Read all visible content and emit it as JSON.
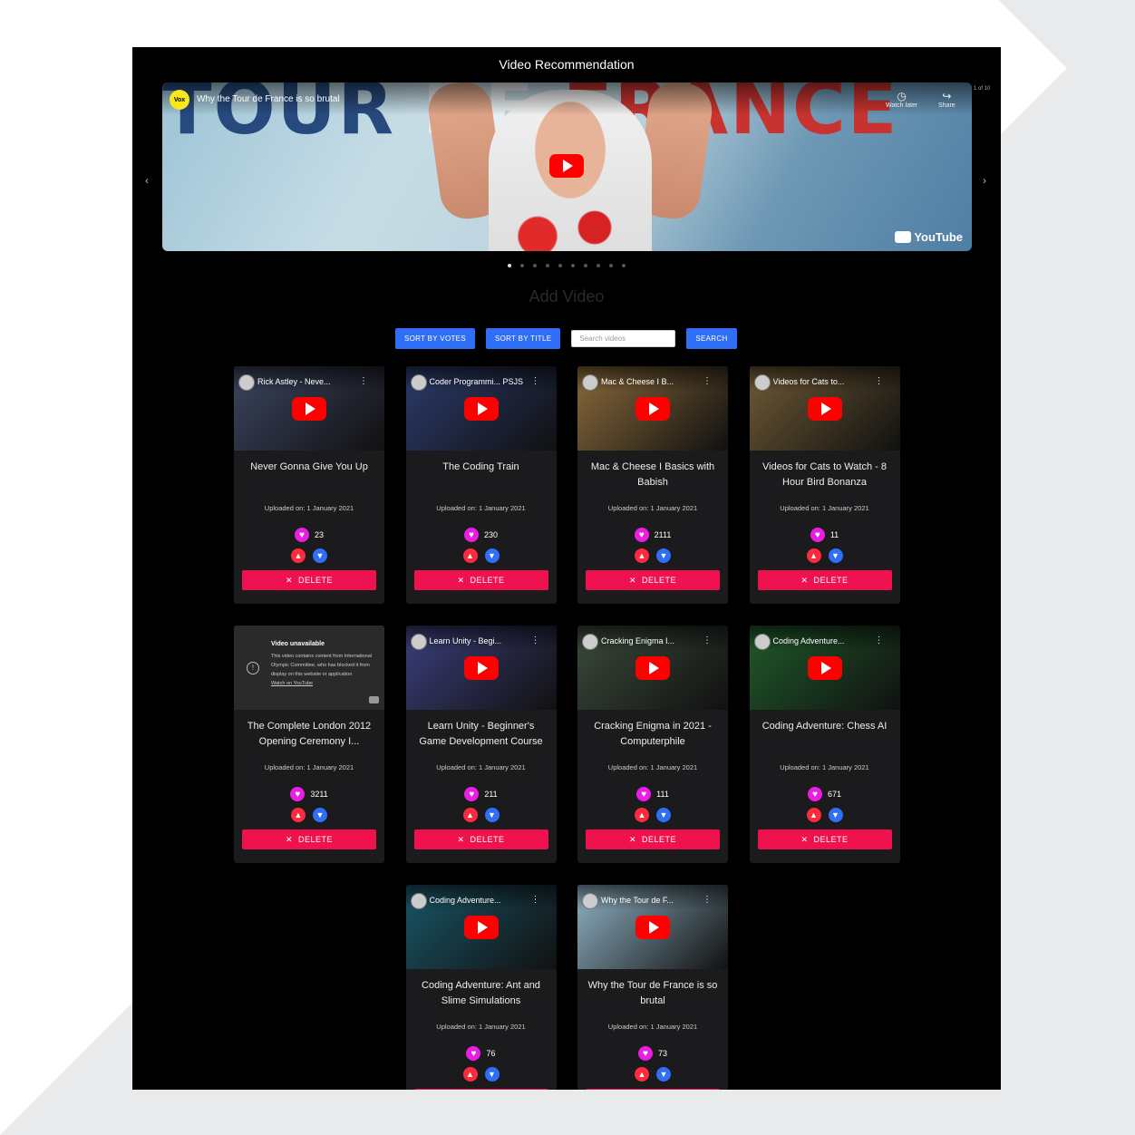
{
  "app": {
    "title": "Video Recommendation"
  },
  "carousel": {
    "prev_icon": "‹",
    "next_icon": "›",
    "video_title": "Why the Tour de France is so brutal",
    "channel_badge": "Vox",
    "watch_later_label": "Watch later",
    "share_label": "Share",
    "page_count": "1 of 10",
    "hero_word_1": "TOUR",
    "hero_word_2": "DE",
    "hero_word_3": "FRANCE",
    "youtube_label": "YouTube",
    "dot_count": 10,
    "active_dot": 0
  },
  "add_video": {
    "label": "Add Video"
  },
  "toolbar": {
    "sort_votes_label": "SORT BY VOTES",
    "sort_title_label": "SORT BY TITLE",
    "search_placeholder": "Search videos",
    "search_label": "SEARCH"
  },
  "delete_label": "DELETE",
  "videos": [
    {
      "thumb_title": "Rick Astley - Neve...",
      "title": "Never Gonna Give You Up",
      "date": "Uploaded on: 1 January 2021",
      "votes": "23",
      "thumb_color": "#3b4560"
    },
    {
      "thumb_title": "Coder Programmi... PSJS",
      "title": "The Coding Train",
      "date": "Uploaded on: 1 January 2021",
      "votes": "230",
      "thumb_color": "#2b3a6b"
    },
    {
      "thumb_title": "Mac & Cheese I B...",
      "title": "Mac & Cheese I Basics with Babish",
      "date": "Uploaded on: 1 January 2021",
      "votes": "2111",
      "thumb_color": "#8a6a3a"
    },
    {
      "thumb_title": "Videos for Cats to...",
      "title": "Videos for Cats to Watch - 8 Hour Bird Bonanza",
      "date": "Uploaded on: 1 January 2021",
      "votes": "11",
      "thumb_color": "#6f5a35"
    },
    {
      "thumb_title": "",
      "title": "The Complete London 2012 Opening Ceremony I...",
      "date": "Uploaded on: 1 January 2021",
      "votes": "3211",
      "thumb_color": "#2a2a2a",
      "unavailable": {
        "heading": "Video unavailable",
        "body": "This video contains content from International Olympic Committee, who has blocked it from display on this website or application",
        "link": "Watch on YouTube"
      }
    },
    {
      "thumb_title": "Learn Unity - Begi...",
      "title": "Learn Unity - Beginner's Game Development Course",
      "date": "Uploaded on: 1 January 2021",
      "votes": "211",
      "thumb_color": "#3b3f7a"
    },
    {
      "thumb_title": "Cracking Enigma I...",
      "title": "Cracking Enigma in 2021 - Computerphile",
      "date": "Uploaded on: 1 January 2021",
      "votes": "111",
      "thumb_color": "#3a4a3a"
    },
    {
      "thumb_title": "Coding Adventure...",
      "title": "Coding Adventure: Chess AI",
      "date": "Uploaded on: 1 January 2021",
      "votes": "671",
      "thumb_color": "#1f5a2a"
    },
    {
      "thumb_title": "Coding Adventure...",
      "title": "Coding Adventure: Ant and Slime Simulations",
      "date": "Uploaded on: 1 January 2021",
      "votes": "76",
      "thumb_color": "#1a5566"
    },
    {
      "thumb_title": "Why the Tour de F...",
      "title": "Why the Tour de France is so brutal",
      "date": "Uploaded on: 1 January 2021",
      "votes": "73",
      "thumb_color": "#8fb2c4"
    }
  ]
}
